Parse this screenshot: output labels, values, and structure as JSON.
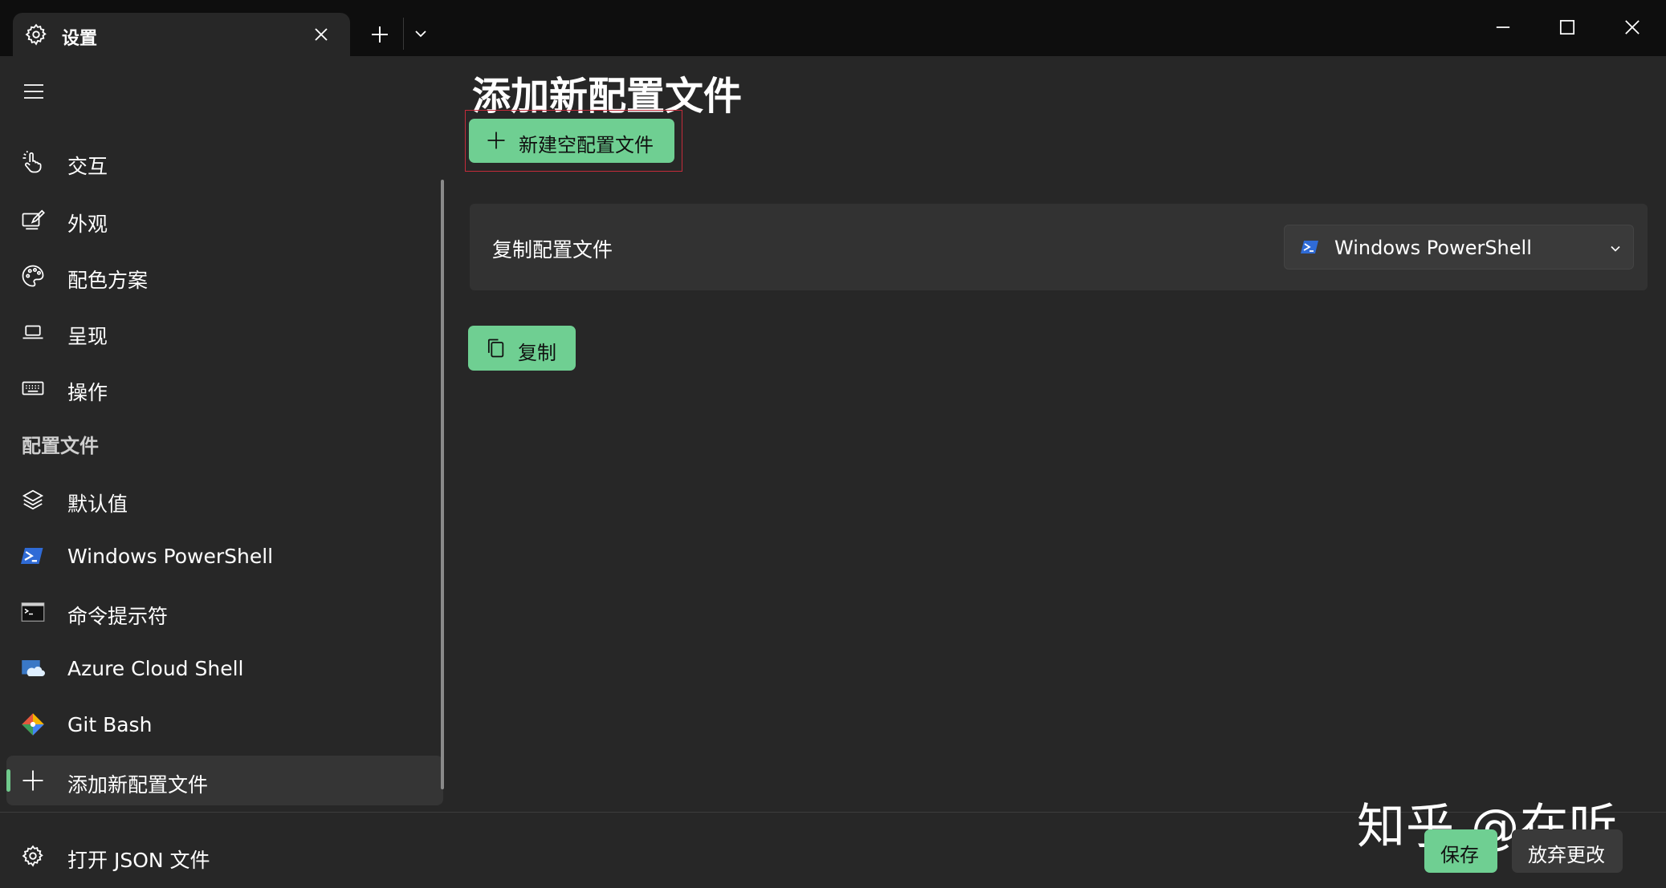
{
  "window": {
    "tab_title": "设置",
    "tab_icon": "gear-icon",
    "controls": [
      "minimize-icon",
      "maximize-icon",
      "close-icon"
    ]
  },
  "sidebar": {
    "items": [
      {
        "label": "交互",
        "icon": "hand-pointer-icon"
      },
      {
        "label": "外观",
        "icon": "paintbrush-icon"
      },
      {
        "label": "配色方案",
        "icon": "palette-icon"
      },
      {
        "label": "呈现",
        "icon": "laptop-icon"
      },
      {
        "label": "操作",
        "icon": "keyboard-icon"
      }
    ],
    "profiles_header": "配置文件",
    "profiles": [
      {
        "label": "默认值",
        "icon": "layers-icon"
      },
      {
        "label": "Windows PowerShell",
        "icon": "powershell-icon"
      },
      {
        "label": "命令提示符",
        "icon": "cmd-icon"
      },
      {
        "label": "Azure Cloud Shell",
        "icon": "azure-cloud-icon"
      },
      {
        "label": "Git Bash",
        "icon": "git-icon"
      },
      {
        "label": "添加新配置文件",
        "icon": "plus-icon",
        "selected": true
      }
    ],
    "open_json": {
      "label": "打开 JSON 文件",
      "icon": "gear-icon"
    }
  },
  "main": {
    "title": "添加新配置文件",
    "new_empty_button": "新建空配置文件",
    "duplicate": {
      "label": "复制配置文件",
      "selected_profile": "Windows PowerShell"
    },
    "duplicate_button": "复制"
  },
  "footer": {
    "save": "保存",
    "discard": "放弃更改"
  },
  "watermark": "知乎 @在听",
  "colors": {
    "accent": "#6fcf92",
    "background": "#272727",
    "titlebar": "#0e0e0e",
    "card": "#323232",
    "focus_outline": "#c42b3a"
  }
}
